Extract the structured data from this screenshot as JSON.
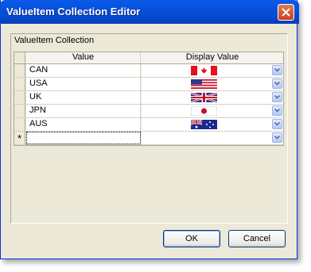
{
  "window": {
    "title": "ValueItem Collection Editor"
  },
  "group": {
    "caption": "ValueItem Collection"
  },
  "grid": {
    "columns": [
      "Value",
      "Display Value"
    ],
    "rows": [
      {
        "value": "CAN",
        "flag": "canada-flag"
      },
      {
        "value": "USA",
        "flag": "usa-flag"
      },
      {
        "value": "UK",
        "flag": "uk-flag"
      },
      {
        "value": "JPN",
        "flag": "japan-flag"
      },
      {
        "value": "AUS",
        "flag": "australia-flag"
      }
    ],
    "new_row_marker": "*"
  },
  "buttons": {
    "ok": "OK",
    "cancel": "Cancel"
  },
  "colors": {
    "title_bar": "#0550dc",
    "dialog_bg": "#ece9d8",
    "close": "#c94320"
  }
}
